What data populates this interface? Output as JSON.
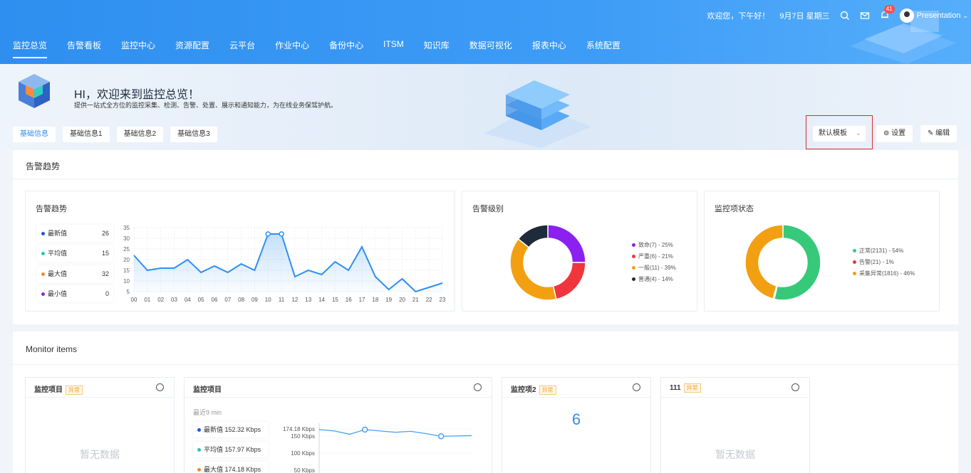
{
  "header": {
    "greeting": "欢迎您，下午好！",
    "date": "9月7日 星期三",
    "bell_count": "41",
    "user": "Presentation",
    "nav": [
      "监控总览",
      "告警看板",
      "监控中心",
      "资源配置",
      "云平台",
      "作业中心",
      "备份中心",
      "ITSM",
      "知识库",
      "数据可视化",
      "报表中心",
      "系统配置"
    ]
  },
  "banner": {
    "title": "HI，欢迎来到监控总览！",
    "subtitle": "提供一站式全方位的监控采集、检测、告警、处置、展示和通知能力，为在线业务保驾护航。",
    "tabs": [
      "基础信息",
      "基础信息1",
      "基础信息2",
      "基础信息3"
    ],
    "template_select": "默认模板",
    "settings_label": "设置",
    "edit_label": "编辑"
  },
  "alert_section": {
    "title": "告警趋势",
    "trend": {
      "title": "告警趋势",
      "stats": [
        {
          "label": "最新值",
          "value": "26",
          "color": "#2456d6"
        },
        {
          "label": "平均值",
          "value": "15",
          "color": "#2ec4b6"
        },
        {
          "label": "最大值",
          "value": "32",
          "color": "#f08c2e"
        },
        {
          "label": "最小值",
          "value": "0",
          "color": "#8a2be2"
        }
      ]
    },
    "level": {
      "title": "告警级别",
      "legend": [
        "致命(7) - 25%",
        "严重(6) - 21%",
        "一般(11) - 39%",
        "普通(4) - 14%"
      ]
    },
    "status": {
      "title": "监控项状态",
      "legend": [
        "正常(2131) - 54%",
        "告警(21) - 1%",
        "采集异常(1816) - 46%"
      ]
    }
  },
  "chart_data": [
    {
      "type": "area",
      "title": "告警趋势",
      "x": [
        "00",
        "01",
        "02",
        "03",
        "04",
        "05",
        "06",
        "07",
        "08",
        "09",
        "10",
        "11",
        "12",
        "13",
        "14",
        "15",
        "16",
        "17",
        "18",
        "19",
        "20",
        "21",
        "22",
        "23"
      ],
      "series": [
        {
          "values": [
            22,
            15,
            16,
            16,
            20,
            14,
            17,
            14,
            18,
            15,
            32,
            32,
            12,
            15,
            13,
            19,
            15,
            26,
            12,
            6,
            11,
            5,
            7,
            9
          ]
        }
      ],
      "yticks": [
        5,
        10,
        15,
        20,
        25,
        30,
        35
      ],
      "ylim": [
        5,
        35
      ],
      "grid": true
    },
    {
      "type": "pie",
      "title": "告警级别",
      "categories": [
        "致命",
        "严重",
        "一般",
        "普通"
      ],
      "values": [
        7,
        6,
        11,
        4
      ],
      "colors": [
        "#8b20f0",
        "#f0353c",
        "#f2a011",
        "#1f2a3a"
      ]
    },
    {
      "type": "pie",
      "title": "监控项状态",
      "categories": [
        "正常",
        "告警",
        "采集异常"
      ],
      "values": [
        2131,
        21,
        1816
      ],
      "colors": [
        "#37c97a",
        "#f0353c",
        "#f2a011"
      ]
    },
    {
      "type": "line",
      "title": "监控项目",
      "yticks": [
        "174.18 Kbps",
        "150 Kbps",
        "100 Kbps",
        "50 Kbps"
      ],
      "series": [
        {
          "values": [
            172,
            168,
            158,
            172,
            168,
            164,
            167,
            160,
            152,
            153,
            154
          ]
        }
      ],
      "unit": "Kbps"
    }
  ],
  "monitor": {
    "title": "Monitor items",
    "cards": [
      {
        "title": "监控项目",
        "tag": "异常",
        "empty": "暂无数据"
      },
      {
        "title": "监控项目",
        "recent": "最近9 min",
        "stats": [
          {
            "label": "最新值",
            "value": "152.32 Kbps",
            "color": "#2456d6"
          },
          {
            "label": "平均值",
            "value": "157.97 Kbps",
            "color": "#2ec4b6"
          },
          {
            "label": "最大值",
            "value": "174.18 Kbps",
            "color": "#f08c2e"
          }
        ]
      },
      {
        "title": "监控项2",
        "tag": "异常",
        "value": "6"
      },
      {
        "title": "111",
        "tag": "异常",
        "empty": "暂无数据"
      }
    ]
  }
}
